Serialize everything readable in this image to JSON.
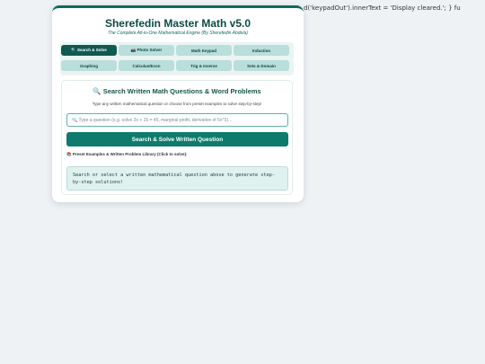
{
  "background_overflow_text": "d('keypadOut').innerText = 'Display cleared.'; } fu",
  "app": {
    "title": "Sherefedin Master Math v5.0",
    "subtitle": "The Complete All-in-One Mathematical Engine (By Sherefedin Abdela)"
  },
  "tabs": [
    {
      "label": "🔍 Search & Solve",
      "active": true
    },
    {
      "label": "📷 Photo Solver",
      "active": false
    },
    {
      "label": "Math Keypad",
      "active": false
    },
    {
      "label": "Induction",
      "active": false
    },
    {
      "label": "Graphing",
      "active": false
    },
    {
      "label": "Calculus/Econ",
      "active": false
    },
    {
      "label": "Trig & Inverse",
      "active": false
    },
    {
      "label": "Sets & Domain",
      "active": false
    }
  ],
  "search_panel": {
    "title": "🔍 Search Written Math Questions & Word Problems",
    "description": "Type any written mathematical question or choose from preset examples to solve step-by-step!",
    "input_value": "",
    "input_placeholder": "🔍 Type a question (e.g. solve 3x + 15 = 45, marginal profit, derivative of 5x^3)...",
    "solve_button": "Search & Solve Written Question",
    "library_label": "📚 Preset Examples & Written Problem Library (Click to solve):",
    "result_text": "Search or select a written mathematical question above to generate step-by-step solutions!"
  },
  "colors": {
    "accent": "#0f7b6c",
    "accent_dark": "#0e5a50",
    "tab_inactive": "#b9dedb",
    "result_bg": "#dff2ef",
    "page_bg": "#eef2f5"
  }
}
